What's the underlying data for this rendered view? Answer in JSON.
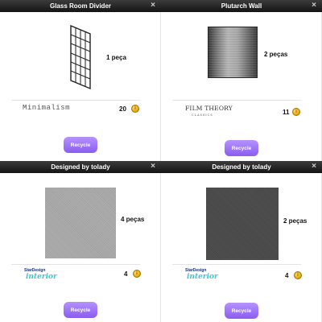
{
  "cards": [
    {
      "title": "Glass Room Divider",
      "close_icon": "×",
      "preview_kind": "glass-grid",
      "piece_count": "1 peça",
      "brand_text": "Minimalism",
      "price": "20",
      "coin_icon": "coin-icon",
      "recycle_label": "Recycle"
    },
    {
      "title": "Plutarch Wall",
      "close_icon": "×",
      "preview_kind": "concrete-wall",
      "piece_count": "2 peças",
      "brand_logo_main": "FILM THEORY",
      "brand_logo_sub": "CLASSICS",
      "price": "11",
      "coin_icon": "coin-icon",
      "recycle_label": "Recycle"
    },
    {
      "title": "Designed by tolady",
      "close_icon": "×",
      "preview_kind": "light-gray-tile",
      "piece_count": "4 peças",
      "brand_logo_top": "StarDesign",
      "brand_logo_main": "interior",
      "price": "4",
      "coin_icon": "coin-icon",
      "recycle_label": "Recycle"
    },
    {
      "title": "Designed by tolady",
      "close_icon": "×",
      "preview_kind": "dark-gray-tile",
      "piece_count": "2 peças",
      "brand_logo_top": "StarDesign",
      "brand_logo_main": "interior",
      "price": "4",
      "coin_icon": "coin-icon",
      "recycle_label": "Recycle"
    }
  ],
  "colors": {
    "titlebar": "#1f1f1f",
    "recycle_button": "#9b6ef5",
    "coin": "#e2a400",
    "light_tile": "#a9a9a9",
    "dark_tile": "#4a4a4a"
  }
}
